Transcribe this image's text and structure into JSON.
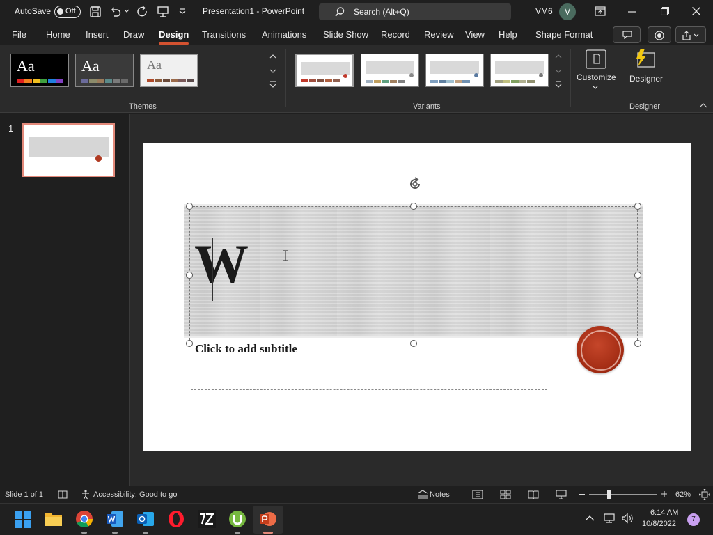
{
  "app": {
    "autosave_label": "AutoSave",
    "autosave_state": "Off",
    "window_title": "Presentation1 - PowerPoint",
    "search_placeholder": "Search (Alt+Q)",
    "user_initials": "VM6",
    "avatar_letter": "V",
    "accent_color": "#d35230"
  },
  "menu": {
    "tabs": [
      "File",
      "Home",
      "Insert",
      "Draw",
      "Design",
      "Transitions",
      "Animations",
      "Slide Show",
      "Record",
      "Review",
      "View",
      "Help",
      "Shape Format"
    ],
    "active": "Design"
  },
  "ribbon": {
    "themes": [
      {
        "label": "Aa",
        "bg": "#000000",
        "fg": "#ffffff",
        "colors": [
          "#e02020",
          "#f08020",
          "#f0c020",
          "#40a040",
          "#2080e0",
          "#8040c0"
        ]
      },
      {
        "label": "Aa",
        "bg": "#3a3a3a",
        "fg": "#ffffff",
        "colors": [
          "#6b6b9b",
          "#8b8b6b",
          "#9b7b5b",
          "#5b8b8b",
          "#7b7b7b",
          "#6b6b6b"
        ]
      },
      {
        "label": "Aa",
        "bg": "#f0f0f0",
        "fg": "#777777",
        "colors": [
          "#b04a2a",
          "#8a5a3a",
          "#6a4a3a",
          "#9a6a4a",
          "#7a5a5a",
          "#5a4a4a"
        ]
      }
    ],
    "themes_group_label": "Themes",
    "variants": [
      {
        "dot": "#c0392b",
        "colors": [
          "#c0392b",
          "#a05040",
          "#805040",
          "#b06040",
          "#906050"
        ]
      },
      {
        "dot": "#888888",
        "colors": [
          "#a0b0c0",
          "#c0a060",
          "#60a080",
          "#a08060",
          "#808080"
        ]
      },
      {
        "dot": "#5a7aa0",
        "colors": [
          "#80a0c0",
          "#6080a0",
          "#a0c0d0",
          "#c0a080",
          "#7090b0"
        ]
      },
      {
        "dot": "#777777",
        "colors": [
          "#a0a080",
          "#c0c080",
          "#80a060",
          "#b0b090",
          "#909070"
        ]
      }
    ],
    "variants_group_label": "Variants",
    "customize_label": "Customize",
    "designer_label": "Designer",
    "designer_group_label": "Designer"
  },
  "slides_pane": {
    "slide_number": "1"
  },
  "slide": {
    "title_text": "W",
    "subtitle_placeholder": "Click to add subtitle"
  },
  "status": {
    "slide_info": "Slide 1 of 1",
    "accessibility": "Accessibility: Good to go",
    "notes_label": "Notes",
    "zoom": "62%"
  },
  "taskbar": {
    "time": "6:14 AM",
    "date": "10/8/2022",
    "notification_count": "7"
  }
}
